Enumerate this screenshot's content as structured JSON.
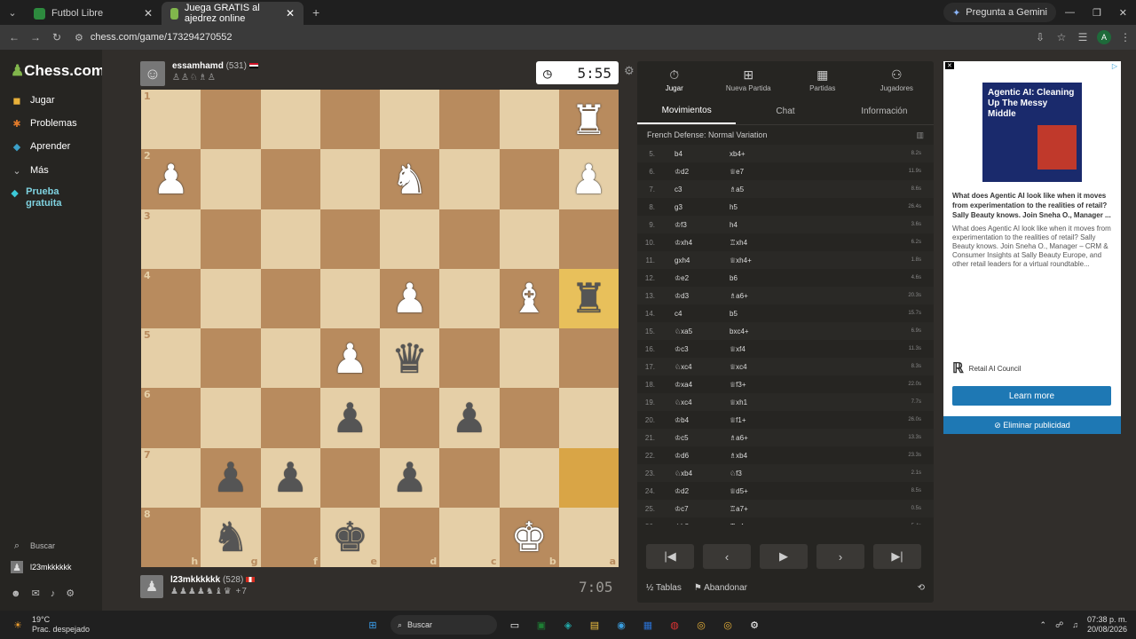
{
  "browser": {
    "tabs": [
      {
        "label": "Futbol Libre",
        "icon": "tv-icon"
      },
      {
        "label": "Juega GRATIS al ajedrez online",
        "icon": "chess-icon"
      }
    ],
    "gemini_label": "Pregunta a Gemini",
    "url": "chess.com/game/173294270552"
  },
  "sidebar": {
    "logo": "Chess.com",
    "items": [
      {
        "label": "Jugar"
      },
      {
        "label": "Problemas"
      },
      {
        "label": "Aprender"
      },
      {
        "label": "Más"
      },
      {
        "label": "Prueba gratuita"
      }
    ],
    "search_label": "Buscar",
    "user_label": "l23mkkkkkk"
  },
  "top_player": {
    "name": "essamhamd",
    "rating": "(531)",
    "captured": "♙♙♘♗♙",
    "clock": "5:55"
  },
  "bottom_player": {
    "name": "l23mkkkkkk",
    "rating": "(528)",
    "captured": "♟♟♟♟♞♝♛ +7",
    "clock": "7:05"
  },
  "board": {
    "ranks": [
      "1",
      "2",
      "3",
      "4",
      "5",
      "6",
      "7",
      "8"
    ],
    "files": [
      "h",
      "g",
      "f",
      "e",
      "d",
      "c",
      "b",
      "a"
    ],
    "rows": [
      [
        "",
        "",
        "",
        "",
        "",
        "",
        "",
        "♜w"
      ],
      [
        "♟w",
        "",
        "",
        "",
        "♞w",
        "",
        "",
        "♟w"
      ],
      [
        "",
        "",
        "",
        "",
        "",
        "",
        "",
        ""
      ],
      [
        "",
        "",
        "",
        "",
        "♟w",
        "",
        "♝w",
        "♜b"
      ],
      [
        "",
        "",
        "",
        "♟w",
        "♛b",
        "",
        "",
        ""
      ],
      [
        "",
        "",
        "",
        "♟b",
        "",
        "♟b",
        "",
        ""
      ],
      [
        "",
        "♟b",
        "♟b",
        "",
        "♟b",
        "",
        "",
        ""
      ],
      [
        "",
        "♞b",
        "",
        "♚b",
        "",
        "",
        "♚w",
        ""
      ]
    ],
    "highlight": [
      [
        3,
        7
      ],
      [
        6,
        7
      ]
    ]
  },
  "right_panel": {
    "tabs": [
      {
        "label": "Jugar",
        "icon": "stopwatch-icon"
      },
      {
        "label": "Nueva Partida",
        "icon": "plus-icon"
      },
      {
        "label": "Partidas",
        "icon": "grid-icon"
      },
      {
        "label": "Jugadores",
        "icon": "people-icon"
      }
    ],
    "subtabs": [
      "Movimientos",
      "Chat",
      "Información"
    ],
    "opening": "French Defense: Normal Variation",
    "moves": [
      {
        "n": "5.",
        "w": "b4",
        "b": "xb4+",
        "t": "8.2s"
      },
      {
        "n": "6.",
        "w": "♔d2",
        "b": "♕e7",
        "t": "11.9s"
      },
      {
        "n": "7.",
        "w": "c3",
        "b": "♗a5",
        "t": "8.6s"
      },
      {
        "n": "8.",
        "w": "g3",
        "b": "h5",
        "t": "26.4s"
      },
      {
        "n": "9.",
        "w": "♔f3",
        "b": "h4",
        "t": "3.6s"
      },
      {
        "n": "10.",
        "w": "♔xh4",
        "b": "♖xh4",
        "t": "6.2s"
      },
      {
        "n": "11.",
        "w": "gxh4",
        "b": "♕xh4+",
        "t": "1.8s"
      },
      {
        "n": "12.",
        "w": "♔e2",
        "b": "b6",
        "t": "4.6s"
      },
      {
        "n": "13.",
        "w": "♔d3",
        "b": "♗a6+",
        "t": "20.3s"
      },
      {
        "n": "14.",
        "w": "c4",
        "b": "b5",
        "t": "15.7s"
      },
      {
        "n": "15.",
        "w": "♘xa5",
        "b": "bxc4+",
        "t": "6.9s"
      },
      {
        "n": "16.",
        "w": "♔c3",
        "b": "♕xf4",
        "t": "11.3s"
      },
      {
        "n": "17.",
        "w": "♘xc4",
        "b": "♕xc4",
        "t": "8.3s"
      },
      {
        "n": "18.",
        "w": "♔xa4",
        "b": "♕f3+",
        "t": "22.0s"
      },
      {
        "n": "19.",
        "w": "♘xc4",
        "b": "♕xh1",
        "t": "7.7s"
      },
      {
        "n": "20.",
        "w": "♔b4",
        "b": "♕f1+",
        "t": "26.0s"
      },
      {
        "n": "21.",
        "w": "♔c5",
        "b": "♗a6+",
        "t": "13.3s"
      },
      {
        "n": "22.",
        "w": "♔d6",
        "b": "♗xb4",
        "t": "23.3s"
      },
      {
        "n": "23.",
        "w": "♘xb4",
        "b": "♘f3",
        "t": "2.1s"
      },
      {
        "n": "24.",
        "w": "♔d2",
        "b": "♕d5+",
        "t": "8.5s"
      },
      {
        "n": "25.",
        "w": "♔c7",
        "b": "♖a7+",
        "t": "0.5s"
      },
      {
        "n": "26.",
        "w": "♔b8",
        "b": "♖a4",
        "t": "5.4s"
      }
    ],
    "controls": [
      "|◀",
      "‹",
      "▶",
      "›",
      "▶|"
    ],
    "draw_label": "Tablas",
    "resign_label": "Abandonar"
  },
  "ad": {
    "headline": "What does Agentic AI look like when it moves from experimentation to the realities of retail? Sally Beauty knows. Join Sneha O., Manager ...",
    "body": "What does Agentic AI look like when it moves from experimentation to the realities of retail? Sally Beauty knows. Join Sneha O., Manager – CRM & Consumer Insights at Sally Beauty Europe, and other retail leaders for a virtual roundtable...",
    "image_text": "Agentic AI: Cleaning Up The Messy Middle",
    "brand": "Retail AI Council",
    "cta": "Learn more",
    "remove": "Eliminar publicidad"
  },
  "taskbar": {
    "weather_temp": "19°C",
    "weather_desc": "Prac. despejado",
    "search_label": "Buscar",
    "time": "07:38 p. m.",
    "date": "20/08/2026"
  }
}
